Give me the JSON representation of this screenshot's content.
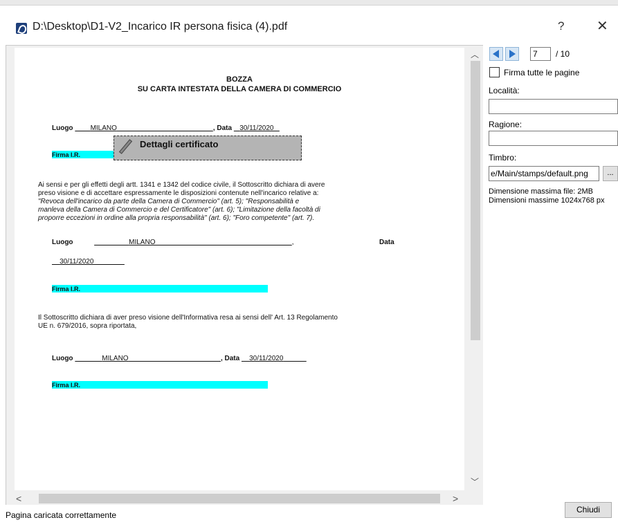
{
  "window": {
    "title": "D:\\Desktop\\D1-V2_Incarico IR persona fisica (4).pdf",
    "help_label": "?",
    "close_label": "✕"
  },
  "document": {
    "title_line1": "BOZZA",
    "title_line2": "SU CARTA INTESTATA DELLA CAMERA DI COMMERCIO",
    "luogo_label": "Luogo",
    "data_label": ", Data",
    "data_label_plain": "Data",
    "city": "MILANO",
    "date": "30/11/2020",
    "firma_label": "Firma I.R.",
    "certificate_label": "Dettagli certificato",
    "paragraph1": [
      "Ai sensi e per gli effetti degli artt. 1341 e 1342 del codice civile, il Sottoscritto dichiara di avere",
      "preso visione e di accettare espressamente le disposizioni contenute nell'incarico relative a:",
      "\"Revoca dell'incarico da parte della Camera di Commercio\" (art. 5); \"Responsabilità e",
      "manleva della Camera di Commercio e del Certificatore\" (art. 6); \"Limitazione della facoltà di",
      "proporre eccezioni in ordine alla propria responsabilità\" (art. 6); \"Foro competente\" (art. 7)."
    ],
    "paragraph2": [
      "Il Sottoscritto dichiara di aver preso visione dell'Informativa resa ai sensi dell' Art. 13 Regolamento",
      "UE n. 679/2016, sopra riportata,"
    ]
  },
  "side_panel": {
    "current_page": "7",
    "total_pages": "/ 10",
    "sign_all_label": "Firma tutte le pagine",
    "sign_all_checked": false,
    "localita_label": "Località:",
    "localita_value": "",
    "ragione_label": "Ragione:",
    "ragione_value": "",
    "timbro_label": "Timbro:",
    "timbro_value": "e/Main/stamps/default.png",
    "browse_label": "...",
    "max_file_size": "Dimensione massima file: 2MB",
    "max_dimensions": "Dimensioni massime 1024x768 px",
    "close_button": "Chiudi"
  },
  "status": {
    "text": "Pagina caricata correttamente"
  },
  "icons": {
    "app": "pdf-sign-icon",
    "prev": "arrow-left-icon",
    "next": "arrow-right-icon",
    "pen": "pen-icon"
  }
}
